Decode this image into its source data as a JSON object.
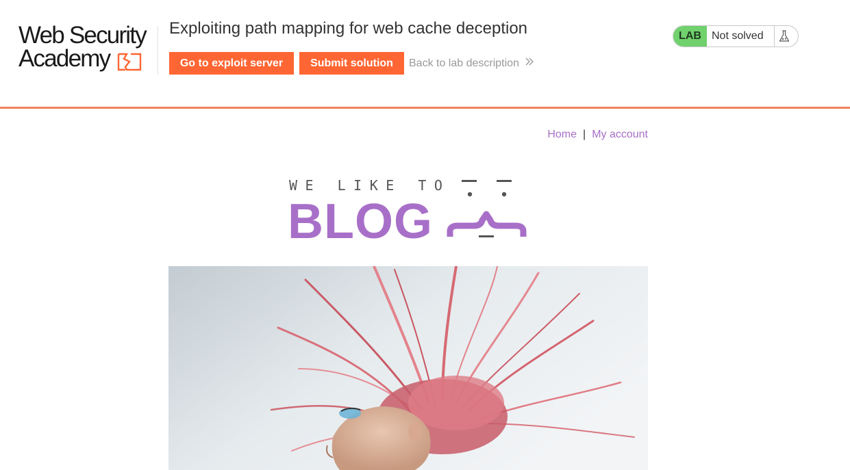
{
  "lab": {
    "logo": {
      "line1": "Web Security",
      "line2": "Academy"
    },
    "title": "Exploiting path mapping for web cache deception",
    "buttons": {
      "exploit_server": "Go to exploit server",
      "submit_solution": "Submit solution"
    },
    "back_link": "Back to lab description",
    "status": {
      "badge": "LAB",
      "text": "Not solved"
    },
    "colors": {
      "accent": "#ff6633",
      "rule": "#f0855c",
      "lab_badge": "#70d16d"
    }
  },
  "blog": {
    "nav": {
      "home": "Home",
      "separator": "|",
      "account": "My account"
    },
    "banner": {
      "tagline": "WE LIKE TO",
      "word": "BLOG"
    },
    "colors": {
      "brand": "#a86fc8"
    },
    "hero_image": {
      "icon": "hero-photo"
    }
  },
  "icons": {
    "chevron": "double-chevron-right-icon",
    "flask": "flask-icon"
  }
}
